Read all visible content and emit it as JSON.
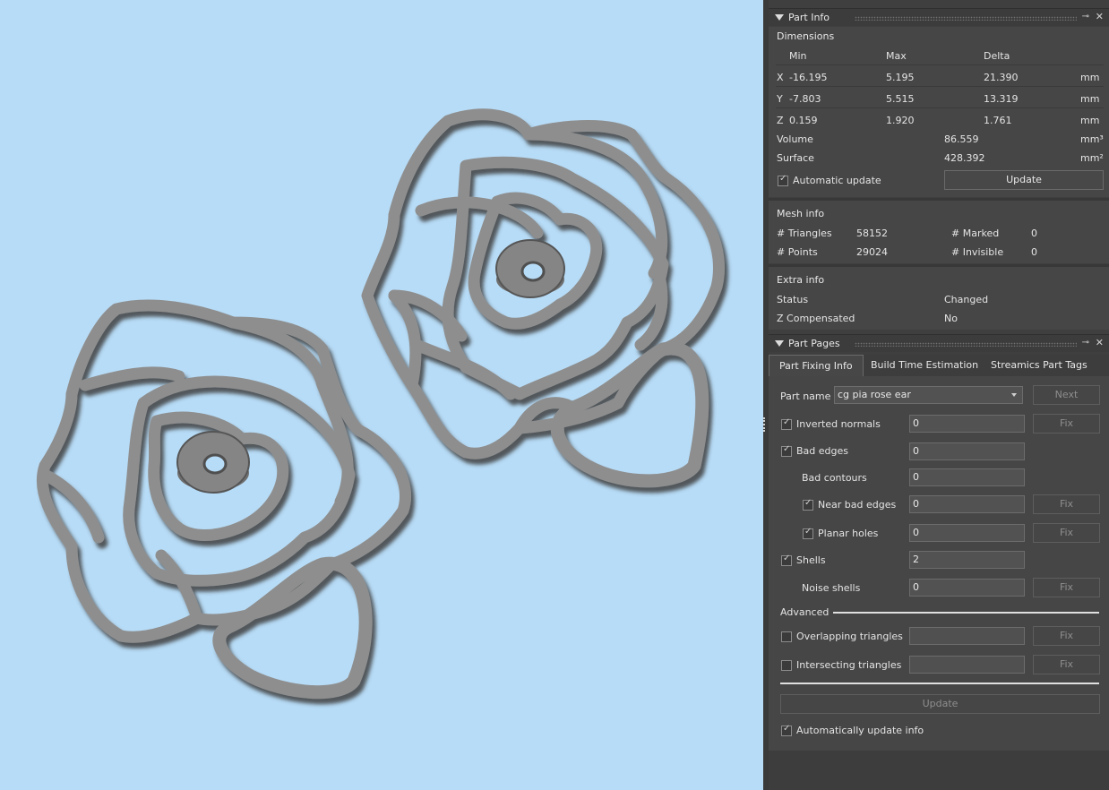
{
  "part_info": {
    "title": "Part Info",
    "dimensions": {
      "title": "Dimensions",
      "headers": [
        "Min",
        "Max",
        "Delta"
      ],
      "rows": [
        {
          "axis": "X",
          "min": "-16.195",
          "max": "5.195",
          "delta": "21.390",
          "unit": "mm"
        },
        {
          "axis": "Y",
          "min": "-7.803",
          "max": "5.515",
          "delta": "13.319",
          "unit": "mm"
        },
        {
          "axis": "Z",
          "min": "0.159",
          "max": "1.920",
          "delta": "1.761",
          "unit": "mm"
        }
      ],
      "volume_label": "Volume",
      "volume": "86.559",
      "volume_unit": "mm³",
      "surface_label": "Surface",
      "surface": "428.392",
      "surface_unit": "mm²",
      "auto_update_label": "Automatic update",
      "auto_update_checked": true,
      "update_label": "Update"
    },
    "mesh": {
      "title": "Mesh info",
      "triangles_label": "# Triangles",
      "triangles": "58152",
      "points_label": "# Points",
      "points": "29024",
      "marked_label": "# Marked",
      "marked": "0",
      "invisible_label": "# Invisible",
      "invisible": "0"
    },
    "extra": {
      "title": "Extra info",
      "status_label": "Status",
      "status": "Changed",
      "zcomp_label": "Z Compensated",
      "zcomp": "No"
    }
  },
  "part_pages": {
    "title": "Part Pages",
    "tabs": [
      "Part Fixing Info",
      "Build Time Estimation",
      "Streamics Part Tags"
    ],
    "part_name_label": "Part name",
    "part_name": "cg pia rose ear",
    "next_label": "Next",
    "fix_label": "Fix",
    "items": {
      "inverted_normals": {
        "label": "Inverted normals",
        "value": "0",
        "checked": true
      },
      "bad_edges": {
        "label": "Bad edges",
        "value": "0",
        "checked": true
      },
      "bad_contours": {
        "label": "Bad contours",
        "value": "0"
      },
      "near_bad_edges": {
        "label": "Near bad edges",
        "value": "0",
        "checked": true
      },
      "planar_holes": {
        "label": "Planar holes",
        "value": "0",
        "checked": true
      },
      "shells": {
        "label": "Shells",
        "value": "2",
        "checked": true
      },
      "noise_shells": {
        "label": "Noise shells",
        "value": "0"
      }
    },
    "advanced_label": "Advanced",
    "overlapping": {
      "label": "Overlapping triangles",
      "value": "",
      "checked": false
    },
    "intersecting": {
      "label": "Intersecting triangles",
      "value": "",
      "checked": false
    },
    "update_label": "Update",
    "auto_update_label": "Automatically update info",
    "auto_update_checked": true
  },
  "colors": {
    "viewport_bg": "#b7dcf7",
    "model": "#8f8f8f",
    "panel_bg": "#464646"
  }
}
